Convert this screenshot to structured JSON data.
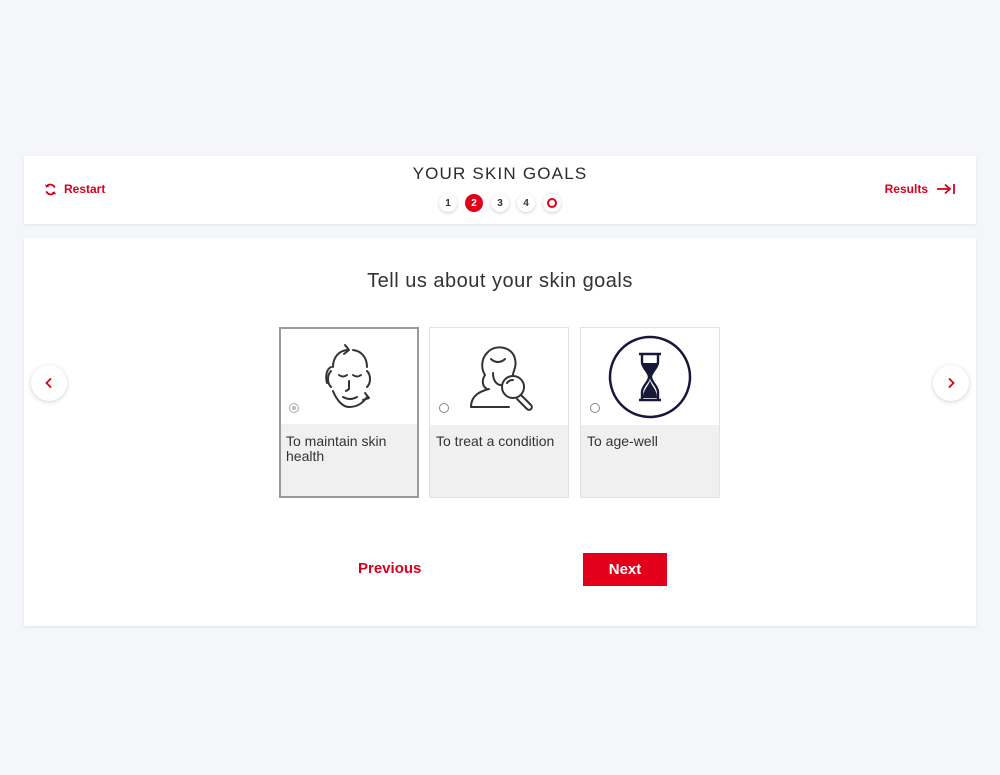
{
  "header": {
    "title": "YOUR SKIN GOALS",
    "restart_label": "Restart",
    "results_label": "Results",
    "steps": [
      "1",
      "2",
      "3",
      "4"
    ],
    "active_step": 2,
    "accent_color": "#e3001b"
  },
  "main": {
    "question": "Tell us about your skin goals",
    "options": [
      {
        "label": "To maintain skin health",
        "icon": "face-arrows-icon",
        "selected": true
      },
      {
        "label": "To treat a condition",
        "icon": "magnifier-face-icon",
        "selected": false
      },
      {
        "label": "To age-well",
        "icon": "hourglass-icon",
        "selected": false
      }
    ],
    "previous_label": "Previous",
    "next_label": "Next"
  }
}
